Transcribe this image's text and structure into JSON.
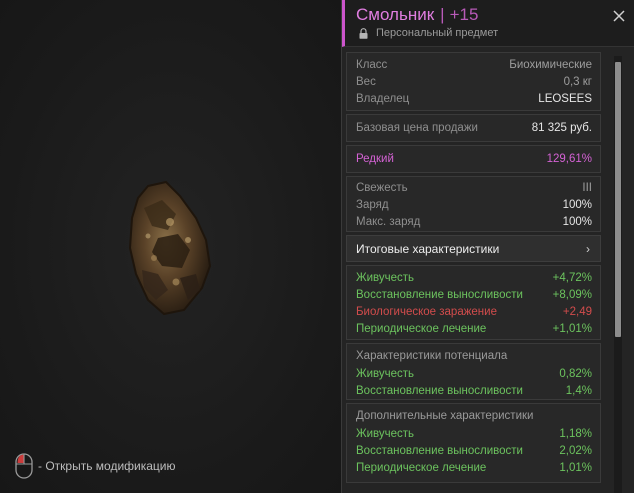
{
  "hint": {
    "text": "- Открыть модификацию",
    "icon": "mouse-icon"
  },
  "panel": {
    "title": "Смольник",
    "separator": "|",
    "level": "+15",
    "subtitle": "Персональный предмет",
    "accent": "#cc55cc"
  },
  "basic": {
    "class_label": "Класс",
    "class_value": "Биохимические",
    "weight_label": "Вес",
    "weight_value": "0,3 кг",
    "owner_label": "Владелец",
    "owner_value": "LEOSEES"
  },
  "price": {
    "label": "Базовая цена продажи",
    "value": "81 325 руб."
  },
  "rarity": {
    "label": "Редкий",
    "value": "129,61%"
  },
  "state": {
    "freshness_label": "Свежесть",
    "freshness_value": "III",
    "charge_label": "Заряд",
    "charge_value": "100%",
    "max_charge_label": "Макс. заряд",
    "max_charge_value": "100%"
  },
  "summary_button": {
    "label": "Итоговые характеристики",
    "chevron": "›"
  },
  "final_stats": [
    {
      "label": "Живучесть",
      "value": "+4,72%"
    },
    {
      "label": "Восстановление выносливости",
      "value": "+8,09%"
    },
    {
      "label": "Биологическое заражение",
      "value": "+2,49"
    },
    {
      "label": "Периодическое лечение",
      "value": "+1,01%"
    }
  ],
  "potential": {
    "title": "Характеристики потенциала",
    "stats": [
      {
        "label": "Живучесть",
        "value": "0,82%"
      },
      {
        "label": "Восстановление выносливости",
        "value": "1,4%"
      }
    ]
  },
  "additional": {
    "title": "Дополнительные характеристики",
    "stats": [
      {
        "label": "Живучесть",
        "value": "1,18%"
      },
      {
        "label": "Восстановление выносливости",
        "value": "2,02%"
      },
      {
        "label": "Периодическое лечение",
        "value": "1,01%"
      }
    ]
  },
  "colors": {
    "positive": "#6cc35e",
    "negative": "#d24c4c",
    "rare": "#d462d4"
  }
}
